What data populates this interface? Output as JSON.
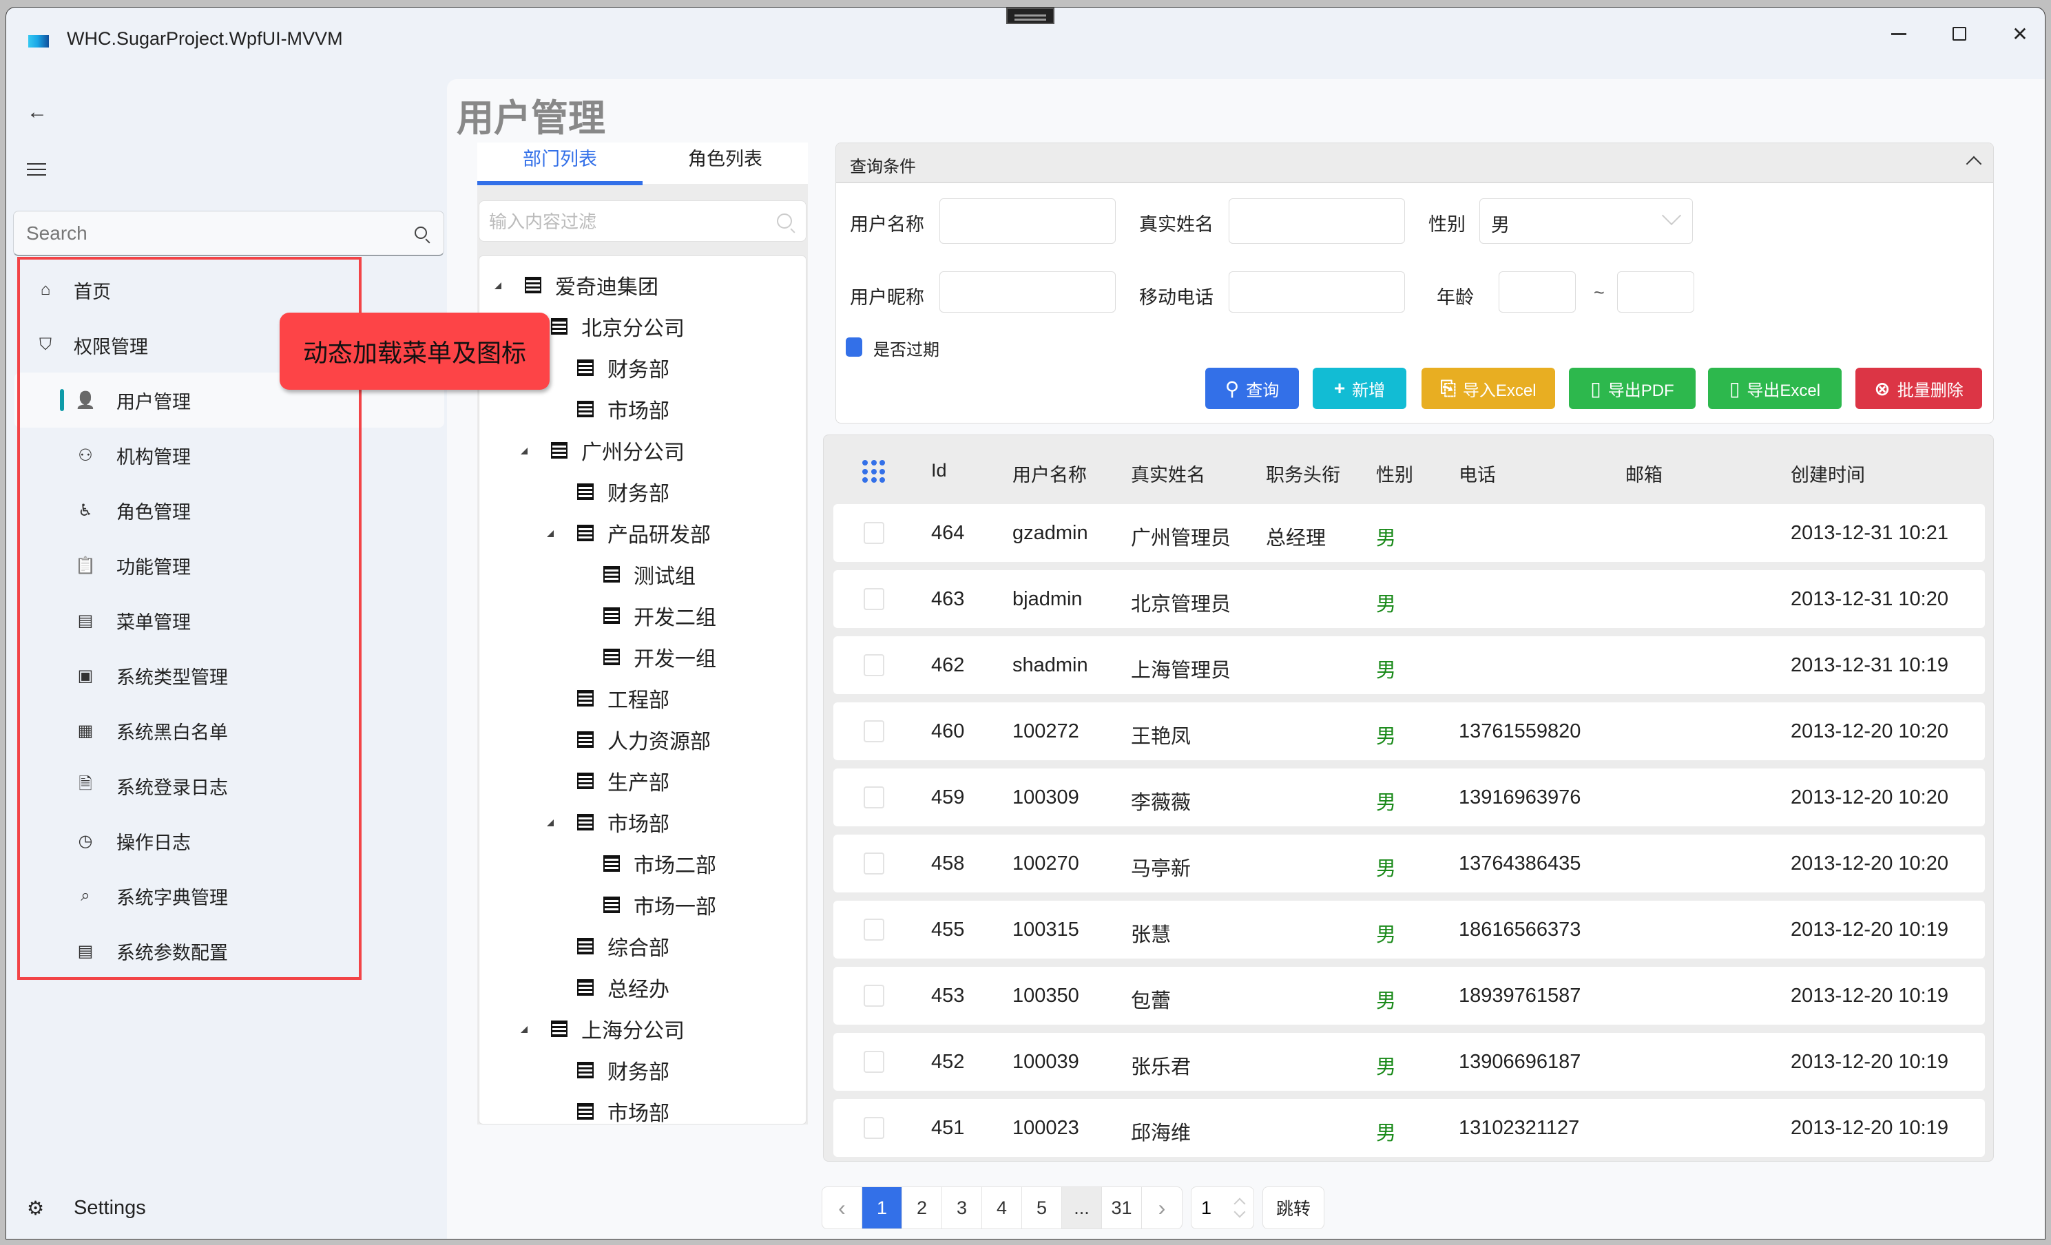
{
  "window": {
    "title": "WHC.SugarProject.WpfUI-MVVM",
    "controls": {
      "minimize": "minimize",
      "maximize": "maximize",
      "close": "close"
    }
  },
  "sidebar": {
    "back_icon": "arrow-left-icon",
    "menu_icon": "hamburger-icon",
    "search_placeholder": "Search",
    "items": [
      {
        "label": "首页",
        "icon": "home-icon",
        "level": 0
      },
      {
        "label": "权限管理",
        "icon": "shield-user-icon",
        "level": 0
      },
      {
        "label": "用户管理",
        "icon": "user-lock-icon",
        "level": 1,
        "active": true
      },
      {
        "label": "机构管理",
        "icon": "org-tree-icon",
        "level": 1
      },
      {
        "label": "角色管理",
        "icon": "accessibility-icon",
        "level": 1
      },
      {
        "label": "功能管理",
        "icon": "clipboard-icon",
        "level": 1
      },
      {
        "label": "菜单管理",
        "icon": "menu-board-icon",
        "level": 1
      },
      {
        "label": "系统类型管理",
        "icon": "type-check-icon",
        "level": 1
      },
      {
        "label": "系统黑白名单",
        "icon": "list-user-icon",
        "level": 1
      },
      {
        "label": "系统登录日志",
        "icon": "document-icon",
        "level": 1
      },
      {
        "label": "操作日志",
        "icon": "screen-clock-icon",
        "level": 1
      },
      {
        "label": "系统字典管理",
        "icon": "dictionary-search-icon",
        "level": 1
      },
      {
        "label": "系统参数配置",
        "icon": "form-settings-icon",
        "level": 1
      }
    ],
    "settings_label": "Settings"
  },
  "annotation": {
    "callout_text": "动态加载菜单及图标"
  },
  "page": {
    "title": "用户管理"
  },
  "left_panel": {
    "tabs": [
      {
        "label": "部门列表",
        "active": true
      },
      {
        "label": "角色列表",
        "active": false
      }
    ],
    "filter_placeholder": "输入内容过滤",
    "tree": [
      {
        "label": "爱奇迪集团",
        "level": 0,
        "expanded": true
      },
      {
        "label": "北京分公司",
        "level": 1,
        "expanded": true
      },
      {
        "label": "财务部",
        "level": 2
      },
      {
        "label": "市场部",
        "level": 2
      },
      {
        "label": "广州分公司",
        "level": 1,
        "expanded": true
      },
      {
        "label": "财务部",
        "level": 2
      },
      {
        "label": "产品研发部",
        "level": 2,
        "expanded": true
      },
      {
        "label": "测试组",
        "level": 3
      },
      {
        "label": "开发二组",
        "level": 3
      },
      {
        "label": "开发一组",
        "level": 3
      },
      {
        "label": "工程部",
        "level": 2
      },
      {
        "label": "人力资源部",
        "level": 2
      },
      {
        "label": "生产部",
        "level": 2
      },
      {
        "label": "市场部",
        "level": 2,
        "expanded": true
      },
      {
        "label": "市场二部",
        "level": 3
      },
      {
        "label": "市场一部",
        "level": 3
      },
      {
        "label": "综合部",
        "level": 2
      },
      {
        "label": "总经办",
        "level": 2
      },
      {
        "label": "上海分公司",
        "level": 1,
        "expanded": true
      },
      {
        "label": "财务部",
        "level": 2
      },
      {
        "label": "市场部",
        "level": 2
      }
    ]
  },
  "query": {
    "title": "查询条件",
    "fields": {
      "username_label": "用户名称",
      "username_value": "",
      "realname_label": "真实姓名",
      "realname_value": "",
      "gender_label": "性别",
      "gender_value": "男",
      "nickname_label": "用户昵称",
      "nickname_value": "",
      "mobile_label": "移动电话",
      "mobile_value": "",
      "age_label": "年龄",
      "age_from": "",
      "age_to": "",
      "age_sep": "~"
    },
    "expired_label": "是否过期",
    "expired_checked": true,
    "buttons": [
      {
        "label": "查询",
        "icon": "search-icon",
        "color": "#3370e8"
      },
      {
        "label": "新增",
        "icon": "plus-icon",
        "color": "#12bcd4"
      },
      {
        "label": "导入Excel",
        "icon": "import-icon",
        "color": "#e8ae22"
      },
      {
        "label": "导出PDF",
        "icon": "save-icon",
        "color": "#2db84d"
      },
      {
        "label": "导出Excel",
        "icon": "save-icon",
        "color": "#2db84d"
      },
      {
        "label": "批量删除",
        "icon": "delete-circle-icon",
        "color": "#dc3545"
      }
    ]
  },
  "grid": {
    "columns": [
      "Id",
      "用户名称",
      "真实姓名",
      "职务头衔",
      "性别",
      "电话",
      "邮箱",
      "创建时间"
    ],
    "rows": [
      {
        "id": "464",
        "username": "gzadmin",
        "realname": "广州管理员",
        "title": "总经理",
        "gender": "男",
        "phone": "",
        "email": "",
        "created": "2013-12-31 10:21"
      },
      {
        "id": "463",
        "username": "bjadmin",
        "realname": "北京管理员",
        "title": "",
        "gender": "男",
        "phone": "",
        "email": "",
        "created": "2013-12-31 10:20"
      },
      {
        "id": "462",
        "username": "shadmin",
        "realname": "上海管理员",
        "title": "",
        "gender": "男",
        "phone": "",
        "email": "",
        "created": "2013-12-31 10:19"
      },
      {
        "id": "460",
        "username": "100272",
        "realname": "王艳凤",
        "title": "",
        "gender": "男",
        "phone": "13761559820",
        "email": "",
        "created": "2013-12-20 10:20"
      },
      {
        "id": "459",
        "username": "100309",
        "realname": "李薇薇",
        "title": "",
        "gender": "男",
        "phone": "13916963976",
        "email": "",
        "created": "2013-12-20 10:20"
      },
      {
        "id": "458",
        "username": "100270",
        "realname": "马亭新",
        "title": "",
        "gender": "男",
        "phone": "13764386435",
        "email": "",
        "created": "2013-12-20 10:20"
      },
      {
        "id": "455",
        "username": "100315",
        "realname": "张慧",
        "title": "",
        "gender": "男",
        "phone": "18616566373",
        "email": "",
        "created": "2013-12-20 10:19"
      },
      {
        "id": "453",
        "username": "100350",
        "realname": "包蕾",
        "title": "",
        "gender": "男",
        "phone": "18939761587",
        "email": "",
        "created": "2013-12-20 10:19"
      },
      {
        "id": "452",
        "username": "100039",
        "realname": "张乐君",
        "title": "",
        "gender": "男",
        "phone": "13906696187",
        "email": "",
        "created": "2013-12-20 10:19"
      },
      {
        "id": "451",
        "username": "100023",
        "realname": "邱海维",
        "title": "",
        "gender": "男",
        "phone": "13102321127",
        "email": "",
        "created": "2013-12-20 10:19"
      }
    ],
    "male_color": "#1a8a1a"
  },
  "pager": {
    "prev": "‹",
    "pages": [
      "1",
      "2",
      "3",
      "4",
      "5",
      "...",
      "31"
    ],
    "current": "1",
    "next": "›",
    "goto_value": "1",
    "jump_label": "跳转"
  }
}
